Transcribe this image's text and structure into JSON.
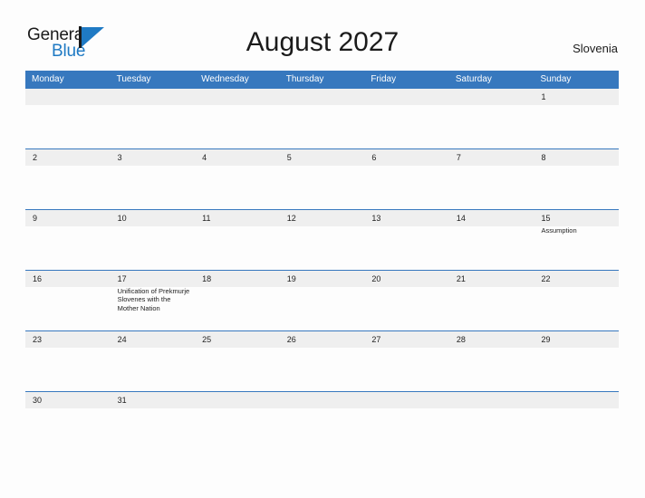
{
  "logo": {
    "word_one": "General",
    "word_two": "Blue",
    "mark_name": "triangle-flag-mark"
  },
  "header": {
    "title": "August 2027",
    "country": "Slovenia"
  },
  "colors": {
    "header_blue": "#3778be",
    "logo_blue": "#1f7ac4",
    "band_gray": "#efefef",
    "text": "#222222",
    "page_bg": "#fdfdfd"
  },
  "calendar": {
    "weekdays": [
      "Monday",
      "Tuesday",
      "Wednesday",
      "Thursday",
      "Friday",
      "Saturday",
      "Sunday"
    ],
    "weeks": [
      {
        "days": [
          {
            "num": "",
            "event": ""
          },
          {
            "num": "",
            "event": ""
          },
          {
            "num": "",
            "event": ""
          },
          {
            "num": "",
            "event": ""
          },
          {
            "num": "",
            "event": ""
          },
          {
            "num": "",
            "event": ""
          },
          {
            "num": "1",
            "event": ""
          }
        ]
      },
      {
        "days": [
          {
            "num": "2",
            "event": ""
          },
          {
            "num": "3",
            "event": ""
          },
          {
            "num": "4",
            "event": ""
          },
          {
            "num": "5",
            "event": ""
          },
          {
            "num": "6",
            "event": ""
          },
          {
            "num": "7",
            "event": ""
          },
          {
            "num": "8",
            "event": ""
          }
        ]
      },
      {
        "days": [
          {
            "num": "9",
            "event": ""
          },
          {
            "num": "10",
            "event": ""
          },
          {
            "num": "11",
            "event": ""
          },
          {
            "num": "12",
            "event": ""
          },
          {
            "num": "13",
            "event": ""
          },
          {
            "num": "14",
            "event": ""
          },
          {
            "num": "15",
            "event": "Assumption"
          }
        ]
      },
      {
        "days": [
          {
            "num": "16",
            "event": ""
          },
          {
            "num": "17",
            "event": "Unification of Prekmurje Slovenes with the Mother Nation"
          },
          {
            "num": "18",
            "event": ""
          },
          {
            "num": "19",
            "event": ""
          },
          {
            "num": "20",
            "event": ""
          },
          {
            "num": "21",
            "event": ""
          },
          {
            "num": "22",
            "event": ""
          }
        ]
      },
      {
        "days": [
          {
            "num": "23",
            "event": ""
          },
          {
            "num": "24",
            "event": ""
          },
          {
            "num": "25",
            "event": ""
          },
          {
            "num": "26",
            "event": ""
          },
          {
            "num": "27",
            "event": ""
          },
          {
            "num": "28",
            "event": ""
          },
          {
            "num": "29",
            "event": ""
          }
        ]
      },
      {
        "days": [
          {
            "num": "30",
            "event": ""
          },
          {
            "num": "31",
            "event": ""
          },
          {
            "num": "",
            "event": ""
          },
          {
            "num": "",
            "event": ""
          },
          {
            "num": "",
            "event": ""
          },
          {
            "num": "",
            "event": ""
          },
          {
            "num": "",
            "event": ""
          }
        ]
      }
    ]
  }
}
